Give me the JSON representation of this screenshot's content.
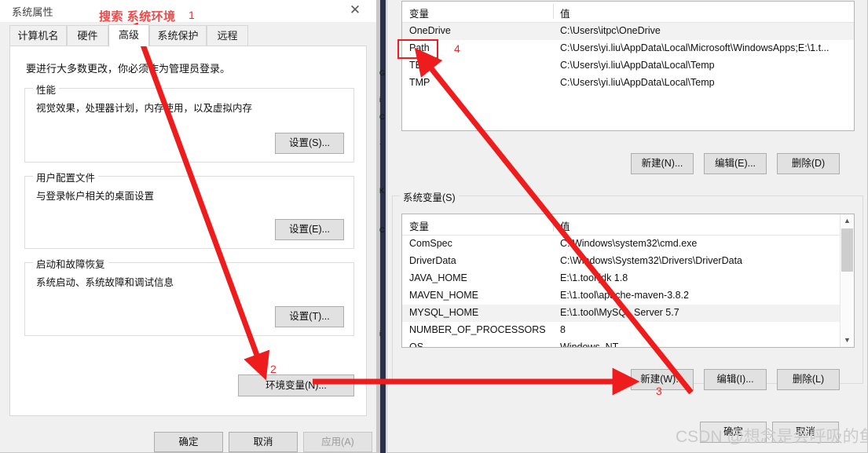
{
  "left_dialog": {
    "title": "系统属性",
    "close_icon": "close-icon",
    "tabs": [
      {
        "label": "计算机名",
        "selected": false
      },
      {
        "label": "硬件",
        "selected": false
      },
      {
        "label": "高级",
        "selected": true
      },
      {
        "label": "系统保护",
        "selected": false
      },
      {
        "label": "远程",
        "selected": false
      }
    ],
    "note": "要进行大多数更改，你必须作为管理员登录。",
    "groups": [
      {
        "title": "性能",
        "desc": "视觉效果，处理器计划，内存使用，以及虚拟内存",
        "button": "设置(S)..."
      },
      {
        "title": "用户配置文件",
        "desc": "与登录帐户相关的桌面设置",
        "button": "设置(E)..."
      },
      {
        "title": "启动和故障恢复",
        "desc": "系统启动、系统故障和调试信息",
        "button": "设置(T)..."
      }
    ],
    "env_button": "环境变量(N)...",
    "footer": {
      "ok": "确定",
      "cancel": "取消",
      "apply": "应用(A)",
      "apply_disabled": true
    }
  },
  "right_dialog": {
    "user_vars": {
      "columns": [
        "变量",
        "值"
      ],
      "rows": [
        {
          "name": "OneDrive",
          "value": "C:\\Users\\itpc\\OneDrive",
          "highlight": true
        },
        {
          "name": "Path",
          "value": "C:\\Users\\yi.liu\\AppData\\Local\\Microsoft\\WindowsApps;E:\\1.t...",
          "highlight": false
        },
        {
          "name": "TEMP",
          "value": "C:\\Users\\yi.liu\\AppData\\Local\\Temp",
          "highlight": false
        },
        {
          "name": "TMP",
          "value": "C:\\Users\\yi.liu\\AppData\\Local\\Temp",
          "highlight": false
        }
      ],
      "buttons": {
        "new": "新建(N)...",
        "edit": "编辑(E)...",
        "delete": "删除(D)"
      }
    },
    "system_vars": {
      "group_title": "系统变量(S)",
      "columns": [
        "变量",
        "值"
      ],
      "rows": [
        {
          "name": "ComSpec",
          "value": "C:\\Windows\\system32\\cmd.exe",
          "highlight": false
        },
        {
          "name": "DriverData",
          "value": "C:\\Windows\\System32\\Drivers\\DriverData",
          "highlight": false
        },
        {
          "name": "JAVA_HOME",
          "value": "E:\\1.tool\\jdk 1.8",
          "highlight": false
        },
        {
          "name": "MAVEN_HOME",
          "value": "E:\\1.tool\\apache-maven-3.8.2",
          "highlight": false
        },
        {
          "name": "MYSQL_HOME",
          "value": "E:\\1.tool\\MySQL Server 5.7",
          "highlight": true
        },
        {
          "name": "NUMBER_OF_PROCESSORS",
          "value": "8",
          "highlight": false
        },
        {
          "name": "OS",
          "value": "Windows_NT",
          "highlight": false
        }
      ],
      "buttons": {
        "new": "新建(W)...",
        "edit": "编辑(I)...",
        "delete": "删除(L)"
      },
      "scroll_up_icon": "chevron-up-icon",
      "scroll_down_icon": "chevron-down-icon"
    },
    "footer": {
      "ok": "确定",
      "cancel": "取消"
    }
  },
  "annotations": {
    "title_text": "搜索 系统环境",
    "step1": "1",
    "step2": "2",
    "step3": "3",
    "step4": "4",
    "arrow_color": "#ee1c1c",
    "label_color": "#ee2b2b"
  },
  "watermark": "CSDN @想念是会呼吸的鱼",
  "background_ghost": {
    "line1": "G",
    "line2": "i",
    "line3": "C",
    "line4": ".",
    "line5": "K",
    "line6": "C",
    "line7": "i"
  }
}
